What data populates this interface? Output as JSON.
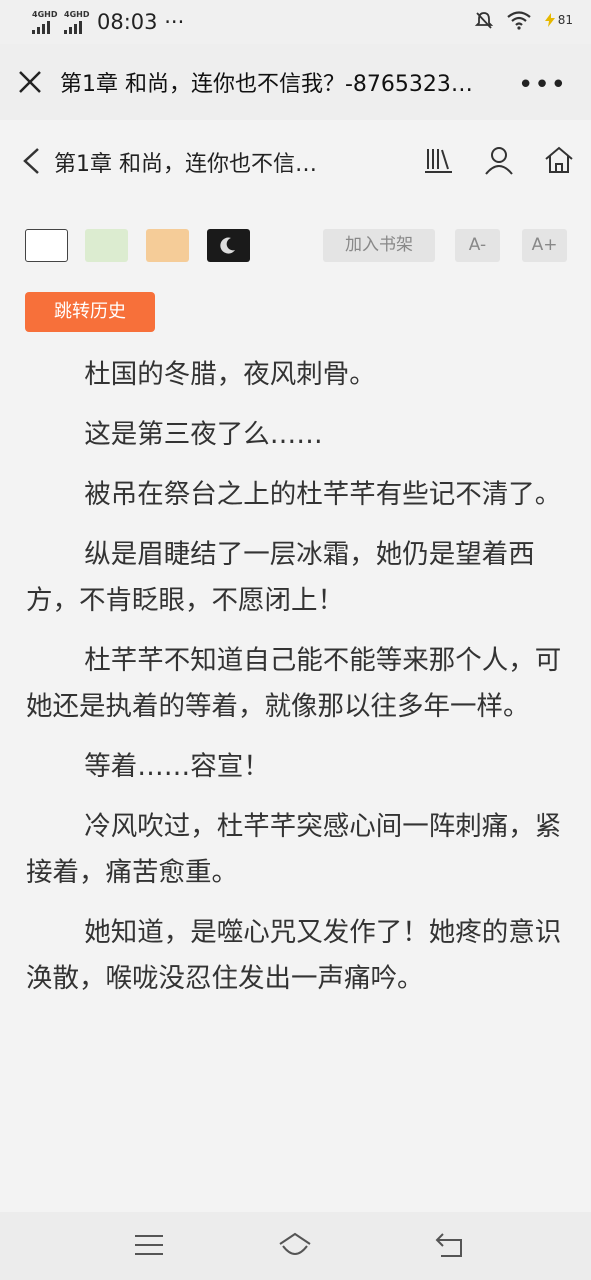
{
  "status_bar": {
    "signal1": "4GHD",
    "signal2": "4GHD",
    "time": "08:03",
    "dots": "···",
    "battery": "81"
  },
  "browser": {
    "title": "第1章 和尚，连你也不信我？-8765323…",
    "more": "•••"
  },
  "reader_header": {
    "chapter_title": "第1章 和尚，连你也不信…"
  },
  "toolbar": {
    "themes": [
      {
        "name": "white",
        "color": "#ffffff"
      },
      {
        "name": "green",
        "color": "#dcecd0"
      },
      {
        "name": "orange",
        "color": "#f5cc98"
      },
      {
        "name": "night",
        "color": "#1a1a1a"
      }
    ],
    "add_shelf": "加入书架",
    "font_smaller": "A-",
    "font_larger": "A+",
    "history": "跳转历史"
  },
  "content": {
    "paragraphs": [
      "杜国的冬腊，夜风刺骨。",
      "这是第三夜了么……",
      "被吊在祭台之上的杜芊芊有些记不清了。",
      "纵是眉睫结了一层冰霜，她仍是望着西方，不肯眨眼，不愿闭上！",
      "杜芊芊不知道自己能不能等来那个人，可她还是执着的等着，就像那以往多年一样。",
      "等着……容宣！",
      "冷风吹过，杜芊芊突感心间一阵刺痛，紧接着，痛苦愈重。",
      "她知道，是噬心咒又发作了！她疼的意识涣散，喉咙没忍住发出一声痛吟。"
    ]
  },
  "colors": {
    "accent": "#f7703a",
    "background": "#f3f3f3"
  }
}
